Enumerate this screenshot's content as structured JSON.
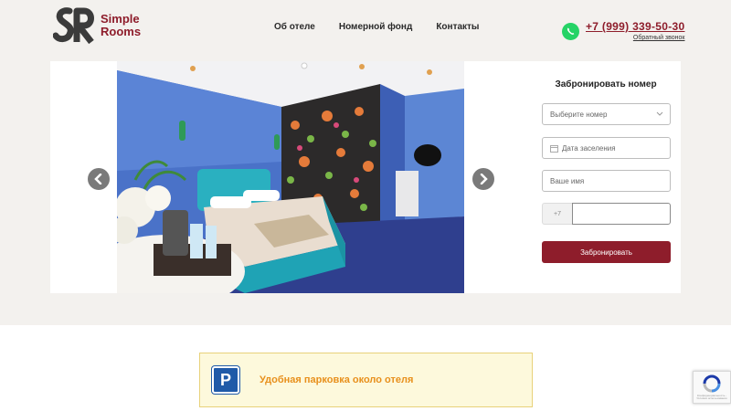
{
  "header": {
    "logo": {
      "line1": "Simple",
      "line2": "Rooms",
      "mark": "SR"
    },
    "nav": [
      "Об отеле",
      "Номерной фонд",
      "Контакты"
    ],
    "phone": "+7 (999) 339-50-30",
    "callback": "Обратный звонок",
    "messenger_icon": "whatsapp-icon"
  },
  "booking": {
    "title": "Забронировать номер",
    "room_select": "Выберите номер",
    "date_placeholder": "Дата заселения",
    "name_placeholder": "Ваше имя",
    "phone_prefix": "+7",
    "submit_label": "Забронировать"
  },
  "banner": {
    "icon_letter": "P",
    "text": "Удобная парковка около отеля"
  },
  "recaptcha": {
    "caption": "Конфиденциальность - Условия использования"
  },
  "colors": {
    "brand": "#8e1d2b",
    "background": "#f3f1ee",
    "banner_text": "#e8901c",
    "parking_blue": "#1f5aa8"
  }
}
